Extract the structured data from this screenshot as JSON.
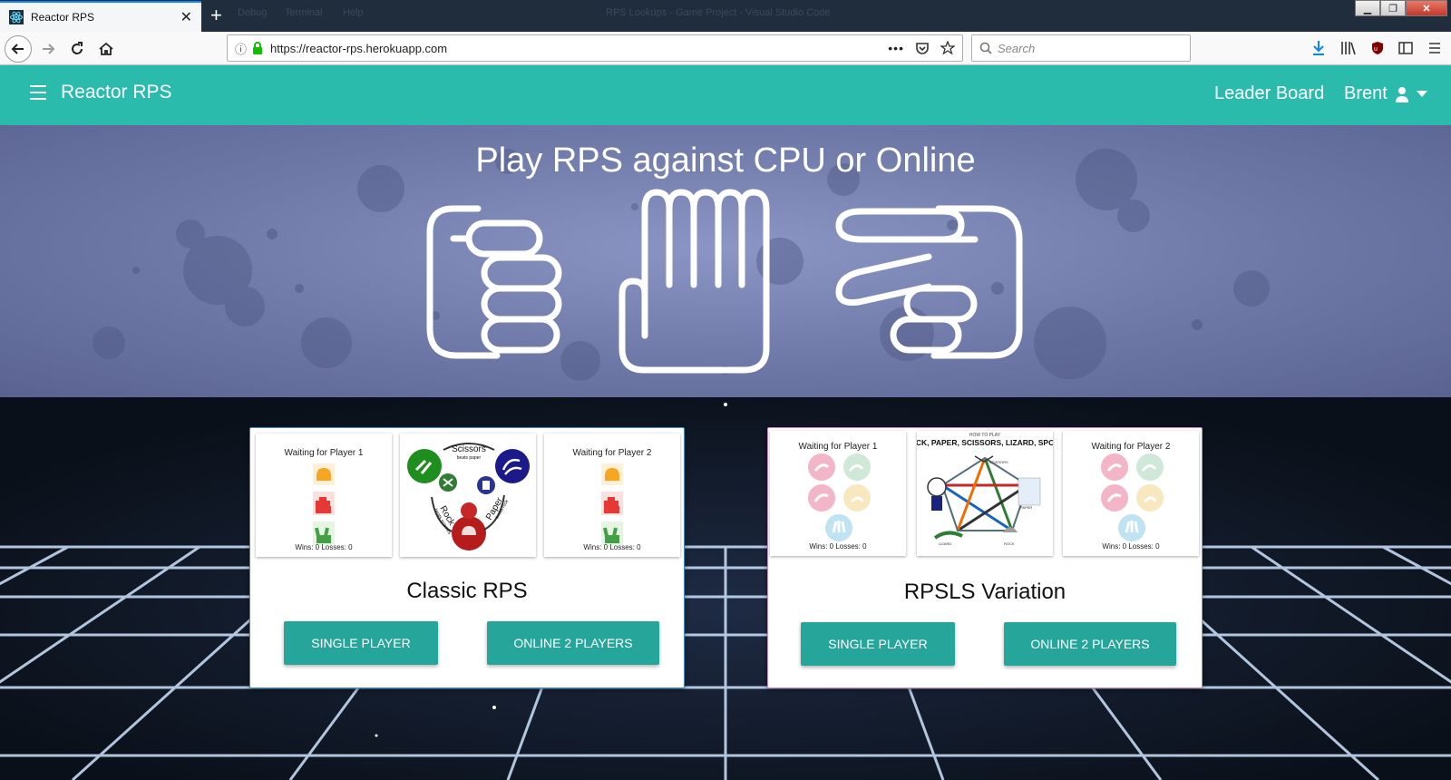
{
  "browser": {
    "tab_title": "Reactor RPS",
    "url": "https://reactor-rps.herokuapp.com",
    "search_placeholder": "Search",
    "bg_menu": [
      "Debug",
      "Terminal",
      "Help"
    ],
    "bg_window_title": "RPS Lookups - Game Project - Visual Studio Code"
  },
  "app": {
    "brand": "Reactor RPS",
    "nav_leaderboard": "Leader Board",
    "user_name": "Brent"
  },
  "hero": {
    "title": "Play RPS against CPU or Online"
  },
  "cards": [
    {
      "title": "Classic RPS",
      "player1_caption": "Waiting for Player 1",
      "player2_caption": "Waiting for Player 2",
      "stats": "Wins: 0    Losses: 0",
      "diagram": {
        "scissors": "Scissors",
        "scissors_sub": "beats paper",
        "rock": "Rock",
        "rock_sub": "beats scissors",
        "paper": "Paper",
        "paper_sub": "beats rock"
      },
      "single_label": "SINGLE PLAYER",
      "online_label": "ONLINE 2 PLAYERS"
    },
    {
      "title": "RPSLS Variation",
      "player1_caption": "Waiting for Player 1",
      "player2_caption": "Waiting for Player 2",
      "stats": "Wins: 0    Losses: 0",
      "diagram": {
        "header_small": "HOW TO PLAY",
        "header": "ROCK, PAPER, SCISSORS, LIZARD, SPOCK",
        "scissors": "SCISSORS",
        "paper": "PAPER",
        "rock": "ROCK",
        "lizard": "LIZARD"
      },
      "single_label": "SINGLE PLAYER",
      "online_label": "ONLINE 2 PLAYERS"
    }
  ],
  "colors": {
    "teal": "#2bbbad",
    "button": "#26a69a",
    "hero": "#7b84b2"
  }
}
